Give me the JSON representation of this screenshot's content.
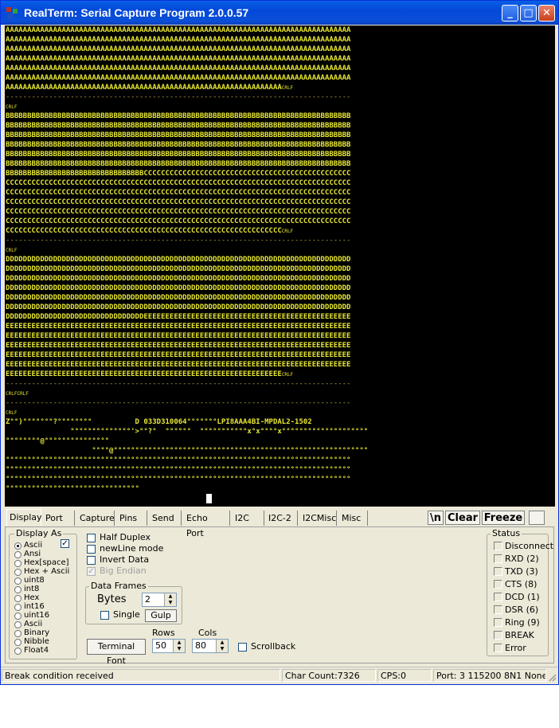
{
  "window": {
    "title": "RealTerm: Serial Capture Program 2.0.0.57",
    "minimize": "_",
    "maximize": "□",
    "close": "✕"
  },
  "terminal": {
    "lines": [
      {
        "text": "AAAAAAAAAAAAAAAAAAAAAAAAAAAAAAAAAAAAAAAAAAAAAAAAAAAAAAAAAAAAAAAAAAAAAAAAAAAAAAAA"
      },
      {
        "text": "AAAAAAAAAAAAAAAAAAAAAAAAAAAAAAAAAAAAAAAAAAAAAAAAAAAAAAAAAAAAAAAAAAAAAAAAAAAAAAAA"
      },
      {
        "text": "AAAAAAAAAAAAAAAAAAAAAAAAAAAAAAAAAAAAAAAAAAAAAAAAAAAAAAAAAAAAAAAAAAAAAAAAAAAAAAAA"
      },
      {
        "text": "AAAAAAAAAAAAAAAAAAAAAAAAAAAAAAAAAAAAAAAAAAAAAAAAAAAAAAAAAAAAAAAAAAAAAAAAAAAAAAAA"
      },
      {
        "text": "AAAAAAAAAAAAAAAAAAAAAAAAAAAAAAAAAAAAAAAAAAAAAAAAAAAAAAAAAAAAAAAAAAAAAAAAAAAAAAAA"
      },
      {
        "text": "AAAAAAAAAAAAAAAAAAAAAAAAAAAAAAAAAAAAAAAAAAAAAAAAAAAAAAAAAAAAAAAAAAAAAAAAAAAAAAAA"
      },
      {
        "text": "AAAAAAAAAAAAAAAAAAAAAAAAAAAAAAAAAAAAAAAAAAAAAAAAAAAAAAAAAAAAAAAA",
        "tag": "CRLF"
      },
      {
        "text": "--------------------------------------------------------------------------------",
        "sep": true
      },
      {
        "text": "",
        "tag": "CRLF"
      },
      {
        "text": "BBBBBBBBBBBBBBBBBBBBBBBBBBBBBBBBBBBBBBBBBBBBBBBBBBBBBBBBBBBBBBBBBBBBBBBBBBBBBBBB"
      },
      {
        "text": "BBBBBBBBBBBBBBBBBBBBBBBBBBBBBBBBBBBBBBBBBBBBBBBBBBBBBBBBBBBBBBBBBBBBBBBBBBBBBBBB"
      },
      {
        "text": "BBBBBBBBBBBBBBBBBBBBBBBBBBBBBBBBBBBBBBBBBBBBBBBBBBBBBBBBBBBBBBBBBBBBBBBBBBBBBBBB"
      },
      {
        "text": "BBBBBBBBBBBBBBBBBBBBBBBBBBBBBBBBBBBBBBBBBBBBBBBBBBBBBBBBBBBBBBBBBBBBBBBBBBBBBBBB"
      },
      {
        "text": "BBBBBBBBBBBBBBBBBBBBBBBBBBBBBBBBBBBBBBBBBBBBBBBBBBBBBBBBBBBBBBBBBBBBBBBBBBBBBBBB"
      },
      {
        "text": "BBBBBBBBBBBBBBBBBBBBBBBBBBBBBBBBBBBBBBBBBBBBBBBBBBBBBBBBBBBBBBBBBBBBBBBBBBBBBBBB"
      },
      {
        "text": "BBBBBBBBBBBBBBBBBBBBBBBBBBBBBBBBCCCCCCCCCCCCCCCCCCCCCCCCCCCCCCCCCCCCCCCCCCCCCCCC"
      },
      {
        "text": "CCCCCCCCCCCCCCCCCCCCCCCCCCCCCCCCCCCCCCCCCCCCCCCCCCCCCCCCCCCCCCCCCCCCCCCCCCCCCCCC"
      },
      {
        "text": "CCCCCCCCCCCCCCCCCCCCCCCCCCCCCCCCCCCCCCCCCCCCCCCCCCCCCCCCCCCCCCCCCCCCCCCCCCCCCCCC"
      },
      {
        "text": "CCCCCCCCCCCCCCCCCCCCCCCCCCCCCCCCCCCCCCCCCCCCCCCCCCCCCCCCCCCCCCCCCCCCCCCCCCCCCCCC"
      },
      {
        "text": "CCCCCCCCCCCCCCCCCCCCCCCCCCCCCCCCCCCCCCCCCCCCCCCCCCCCCCCCCCCCCCCCCCCCCCCCCCCCCCCC"
      },
      {
        "text": "CCCCCCCCCCCCCCCCCCCCCCCCCCCCCCCCCCCCCCCCCCCCCCCCCCCCCCCCCCCCCCCCCCCCCCCCCCCCCCCC"
      },
      {
        "text": "CCCCCCCCCCCCCCCCCCCCCCCCCCCCCCCCCCCCCCCCCCCCCCCCCCCCCCCCCCCCCCCC",
        "tag": "CRLF"
      },
      {
        "text": "--------------------------------------------------------------------------------",
        "sep": true
      },
      {
        "text": "",
        "tag": "CRLF"
      },
      {
        "text": "DDDDDDDDDDDDDDDDDDDDDDDDDDDDDDDDDDDDDDDDDDDDDDDDDDDDDDDDDDDDDDDDDDDDDDDDDDDDDDDD"
      },
      {
        "text": "DDDDDDDDDDDDDDDDDDDDDDDDDDDDDDDDDDDDDDDDDDDDDDDDDDDDDDDDDDDDDDDDDDDDDDDDDDDDDDDD"
      },
      {
        "text": "DDDDDDDDDDDDDDDDDDDDDDDDDDDDDDDDDDDDDDDDDDDDDDDDDDDDDDDDDDDDDDDDDDDDDDDDDDDDDDDD"
      },
      {
        "text": "DDDDDDDDDDDDDDDDDDDDDDDDDDDDDDDDDDDDDDDDDDDDDDDDDDDDDDDDDDDDDDDDDDDDDDDDDDDDDDDD"
      },
      {
        "text": "DDDDDDDDDDDDDDDDDDDDDDDDDDDDDDDDDDDDDDDDDDDDDDDDDDDDDDDDDDDDDDDDDDDDDDDDDDDDDDDD"
      },
      {
        "text": "DDDDDDDDDDDDDDDDDDDDDDDDDDDDDDDDDDDDDDDDDDDDDDDDDDDDDDDDDDDDDDDDDDDDDDDDDDDDDDDD"
      },
      {
        "text": "DDDDDDDDDDDDDDDDDDDDDDDDDDDDDDDDEEEEEEEEEEEEEEEEEEEEEEEEEEEEEEEEEEEEEEEEEEEEEEEE"
      },
      {
        "text": "EEEEEEEEEEEEEEEEEEEEEEEEEEEEEEEEEEEEEEEEEEEEEEEEEEEEEEEEEEEEEEEEEEEEEEEEEEEEEEEE"
      },
      {
        "text": "EEEEEEEEEEEEEEEEEEEEEEEEEEEEEEEEEEEEEEEEEEEEEEEEEEEEEEEEEEEEEEEEEEEEEEEEEEEEEEEE"
      },
      {
        "text": "EEEEEEEEEEEEEEEEEEEEEEEEEEEEEEEEEEEEEEEEEEEEEEEEEEEEEEEEEEEEEEEEEEEEEEEEEEEEEEEE"
      },
      {
        "text": "EEEEEEEEEEEEEEEEEEEEEEEEEEEEEEEEEEEEEEEEEEEEEEEEEEEEEEEEEEEEEEEEEEEEEEEEEEEEEEEE"
      },
      {
        "text": "EEEEEEEEEEEEEEEEEEEEEEEEEEEEEEEEEEEEEEEEEEEEEEEEEEEEEEEEEEEEEEEEEEEEEEEEEEEEEEEE"
      },
      {
        "text": "EEEEEEEEEEEEEEEEEEEEEEEEEEEEEEEEEEEEEEEEEEEEEEEEEEEEEEEEEEEEEEEE",
        "tag": "CRLF"
      },
      {
        "text": "--------------------------------------------------------------------------------",
        "sep": true
      },
      {
        "text": "",
        "tag": "CRLFCRLF"
      },
      {
        "text": "--------------------------------------------------------------------------------",
        "sep": true
      },
      {
        "text": "",
        "tag": "CRLF"
      },
      {
        "text": "Z°°)°°°°°°°?°°°°°°°°          D 033D310064°°°°°°°LPI8AAA4BI-MPDAL2-1502"
      },
      {
        "text": "               °°°°°°°°°°°°°°'>°°?°  °°°°°°  °°°°°°°°°°°x°x°°°°x°°°°°°°°°°°°°°°°°°°°"
      },
      {
        "text": "°°°°°°°°@°°°°°°°°°°°°°°°"
      },
      {
        "text": "                    °°°°@°°°°°°°°°°°°°°°°°°°°°°°°°°°°°°°°°°°°°°°°°°°°°°°°°°°°°°°°°°°"
      },
      {
        "text": "°°°°°°°°°°°°°°°°°°°°°°°°°°°°°°°°°°°°°°°°°°°°°°°°°°°°°°°°°°°°°°°°°°°°°°°°°°°°°°°°"
      },
      {
        "text": "°°°°°°°°°°°°°°°°°°°°°°°°°°°°°°°°°°°°°°°°°°°°°°°°°°°°°°°°°°°°°°°°°°°°°°°°°°°°°°°°"
      },
      {
        "text": "°°°°°°°°°°°°°°°°°°°°°°°°°°°°°°°°°°°°°°°°°°°°°°°°°°°°°°°°°°°°°°°°°°°°°°°°°°°°°°°°"
      },
      {
        "text": "°°°°°°°°°°°°°°°°°°°°°°°°°°°°°°°"
      }
    ]
  },
  "tabs": [
    "Display",
    "Port",
    "Capture",
    "Pins",
    "Send",
    "Echo Port",
    "I2C",
    "I2C-2",
    "I2CMisc",
    "Misc"
  ],
  "right_buttons": {
    "newline": "\\n",
    "clear": "Clear",
    "freeze": "Freeze",
    "extra": ""
  },
  "display_as": {
    "label": "Display As",
    "options": [
      "Ascii",
      "Ansi",
      "Hex[space]",
      "Hex + Ascii",
      "uint8",
      "int8",
      "Hex",
      "int16",
      "uint16",
      "Ascii",
      "Binary",
      "Nibble",
      "Float4"
    ],
    "selected": "Ascii",
    "check": "✓"
  },
  "options": {
    "half_duplex": "Half Duplex",
    "newline_mode": "newLine mode",
    "invert_data": "Invert Data",
    "big_endian": "Big Endian",
    "big_endian_check": "✓"
  },
  "data_frames": {
    "label": "Data Frames",
    "bytes_label": "Bytes",
    "bytes_value": "2",
    "single": "Single",
    "gulp": "Gulp"
  },
  "terminal_font_button": "Terminal Font",
  "rows": {
    "label": "Rows",
    "value": "50"
  },
  "cols": {
    "label": "Cols",
    "value": "80"
  },
  "scrollback": "Scrollback",
  "status": {
    "label": "Status",
    "items": [
      "Disconnect",
      "RXD (2)",
      "TXD (3)",
      "CTS (8)",
      "DCD (1)",
      "DSR (6)",
      "Ring (9)",
      "BREAK",
      "Error"
    ]
  },
  "statusbar": {
    "message": "Break condition received",
    "char_count": "Char Count:7326",
    "cps": "CPS:0",
    "port": "Port: 3 115200 8N1 None"
  },
  "spin_up": "▲",
  "spin_down": "▼"
}
